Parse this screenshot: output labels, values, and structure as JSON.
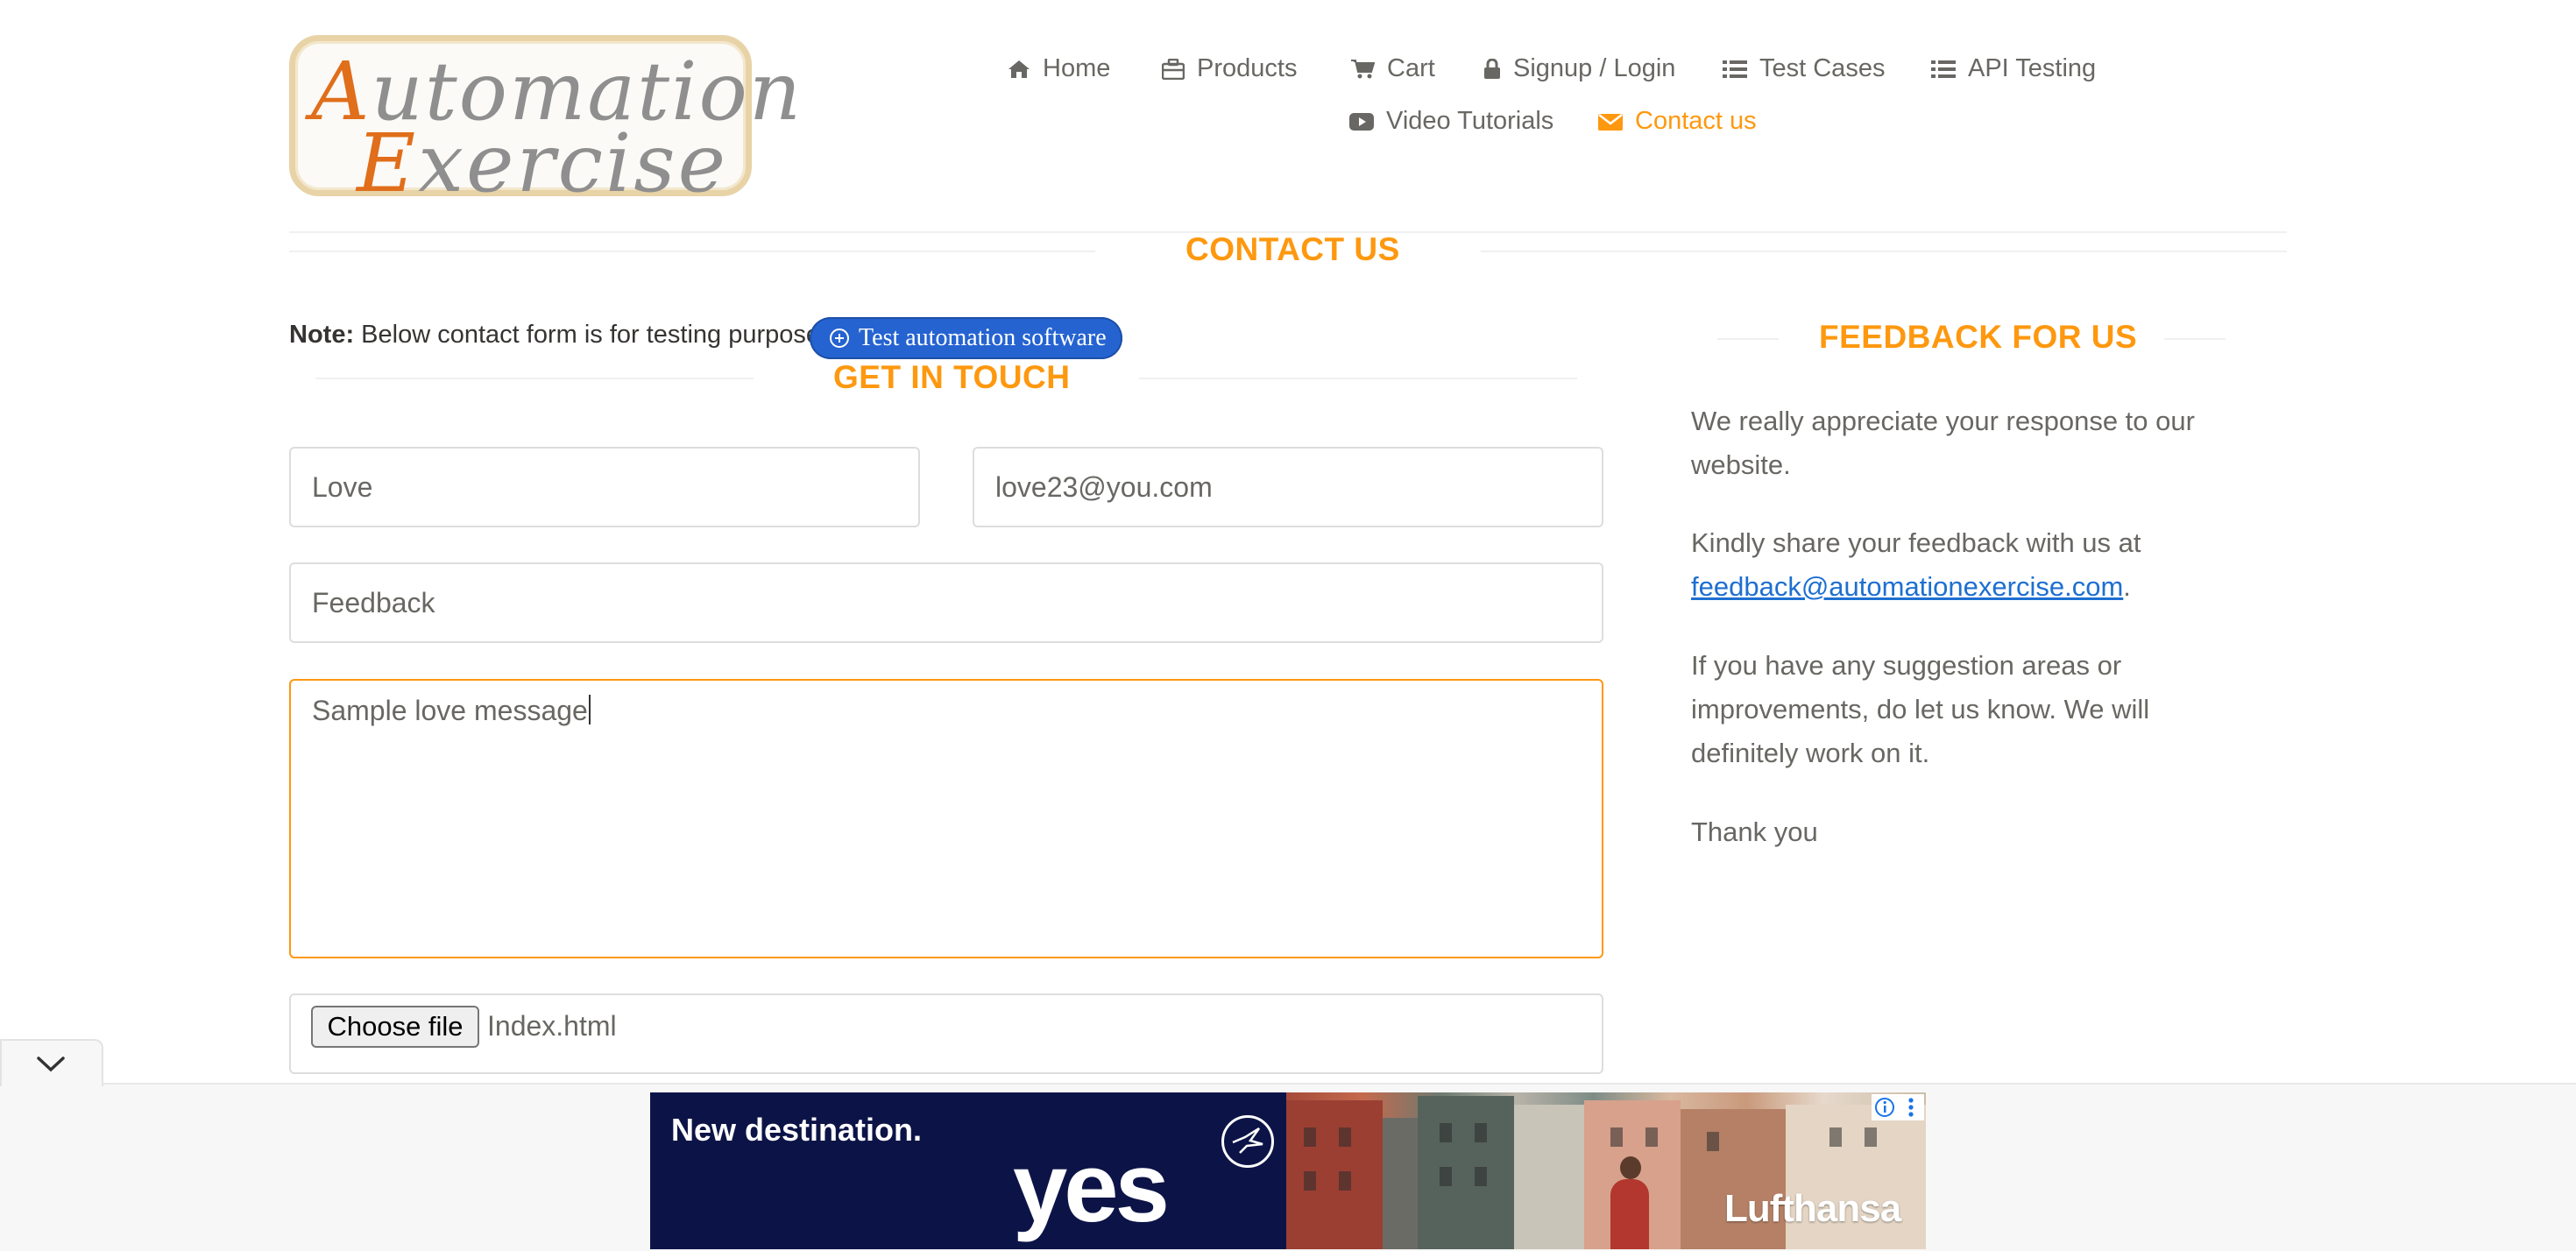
{
  "logo": {
    "line1_cap": "A",
    "line1_rest": "utomation",
    "line2_cap": "E",
    "line2_rest": "xercise"
  },
  "nav": {
    "home": "Home",
    "products": "Products",
    "cart": "Cart",
    "signup": "Signup / Login",
    "test_cases": "Test Cases",
    "api_testing": "API Testing",
    "video_tutorials": "Video Tutorials",
    "contact_us": "Contact us"
  },
  "headings": {
    "contact_us": "CONTACT US",
    "get_in_touch": "GET IN TOUCH",
    "feedback_for_us": "FEEDBACK FOR US"
  },
  "note": {
    "label": "Note:",
    "text": " Below contact form is for testing purpose."
  },
  "pill": {
    "label": "Test automation software"
  },
  "form": {
    "name_value": "Love",
    "email_value": "love23@you.com",
    "subject_value": "Feedback",
    "message_value": "Sample love message",
    "file_button": "Choose file",
    "file_name": "Index.html"
  },
  "feedback": {
    "p1_line1": "We really appreciate your response to our",
    "p1_line2": "website.",
    "p2_line1": "Kindly share your feedback with us at",
    "p2_email": "feedback@automationexercise.com",
    "p2_period": ".",
    "p3_line1": "If you have any suggestion areas or",
    "p3_line2": "improvements, do let us know. We will",
    "p3_line3": "definitely work on it.",
    "p4": "Thank you"
  },
  "ad": {
    "headline": "New destination.",
    "big_word": "yes",
    "brand": "Lufthansa"
  },
  "colors": {
    "accent": "#fe980f",
    "link": "#1d6fd1",
    "pill": "#2563d1",
    "ad_navy": "#0c1447"
  }
}
